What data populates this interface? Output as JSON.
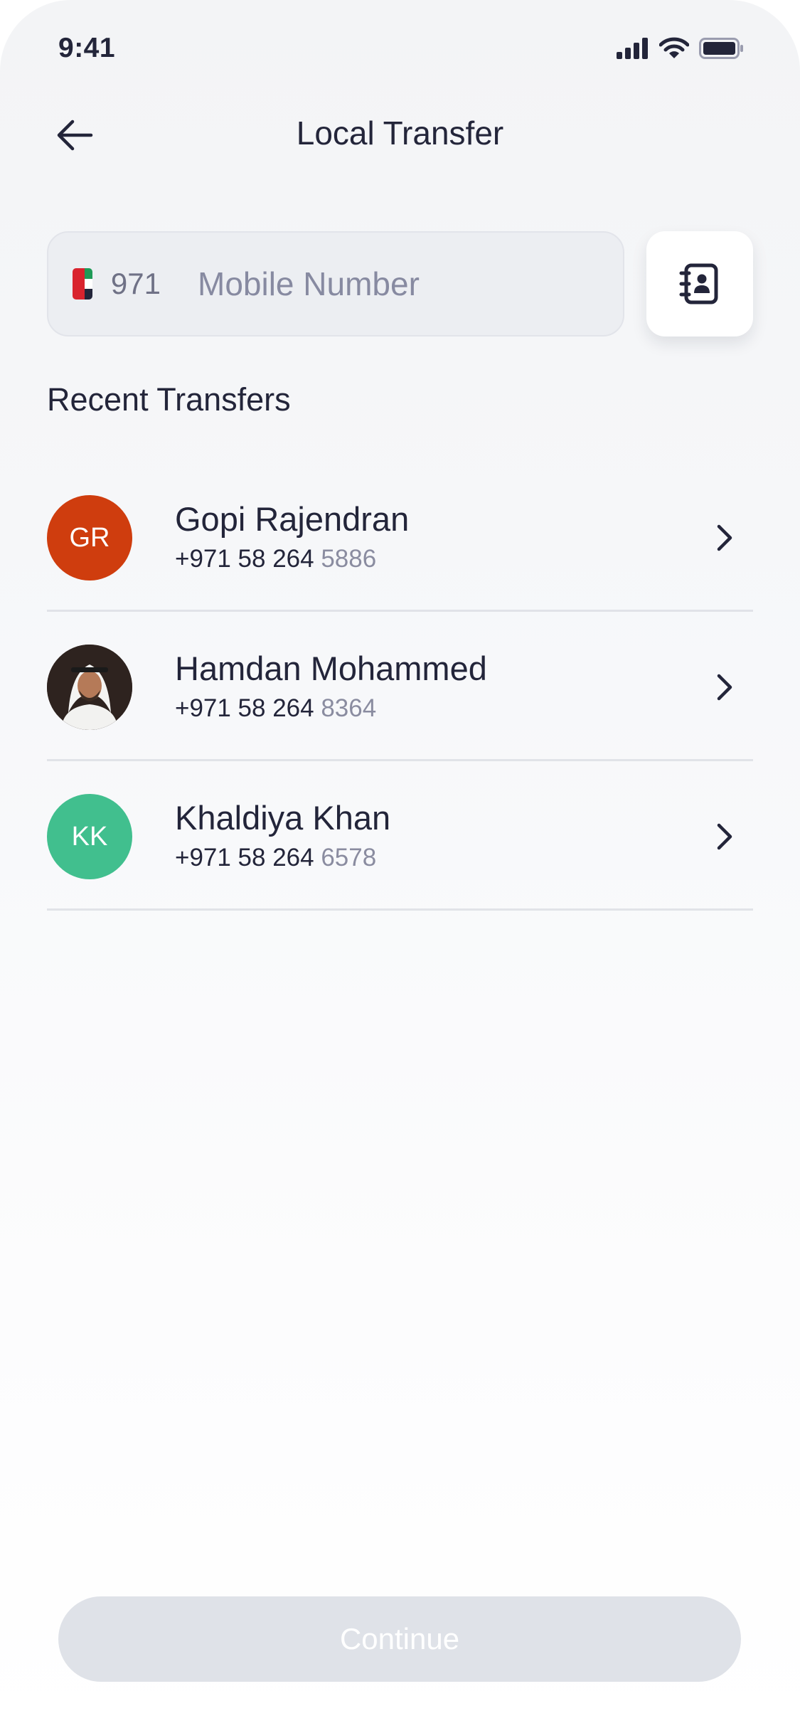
{
  "status_bar": {
    "time": "9:41",
    "icons": [
      "cellular-signal-icon",
      "wifi-icon",
      "battery-icon"
    ]
  },
  "header": {
    "back_icon": "arrow-left-icon",
    "title": "Local Transfer"
  },
  "phone_field": {
    "flag": "uae-flag-icon",
    "country_code": "971",
    "placeholder": "Mobile Number",
    "value": ""
  },
  "contacts_button": {
    "icon": "contact-book-icon"
  },
  "recent": {
    "title": "Recent Transfers",
    "items": [
      {
        "initials": "GR",
        "avatar_color": "#cf3d0e",
        "name": "Gopi Rajendran",
        "phone_prefix": "+971 58 264 ",
        "phone_suffix": "5886"
      },
      {
        "initials": "",
        "avatar_type": "photo",
        "name": "Hamdan Mohammed",
        "phone_prefix": "+971 58 264 ",
        "phone_suffix": "8364"
      },
      {
        "initials": "KK",
        "avatar_color": "#41bf8e",
        "name": "Khaldiya Khan",
        "phone_prefix": "+971 58 264 ",
        "phone_suffix": "6578"
      }
    ]
  },
  "continue_button": {
    "label": "Continue",
    "enabled": false
  },
  "colors": {
    "text_primary": "#23253a",
    "text_muted": "#8a8ca0",
    "divider": "#e1e3e8",
    "input_bg": "#eceef2",
    "button_disabled_bg": "#dfe2e8"
  }
}
